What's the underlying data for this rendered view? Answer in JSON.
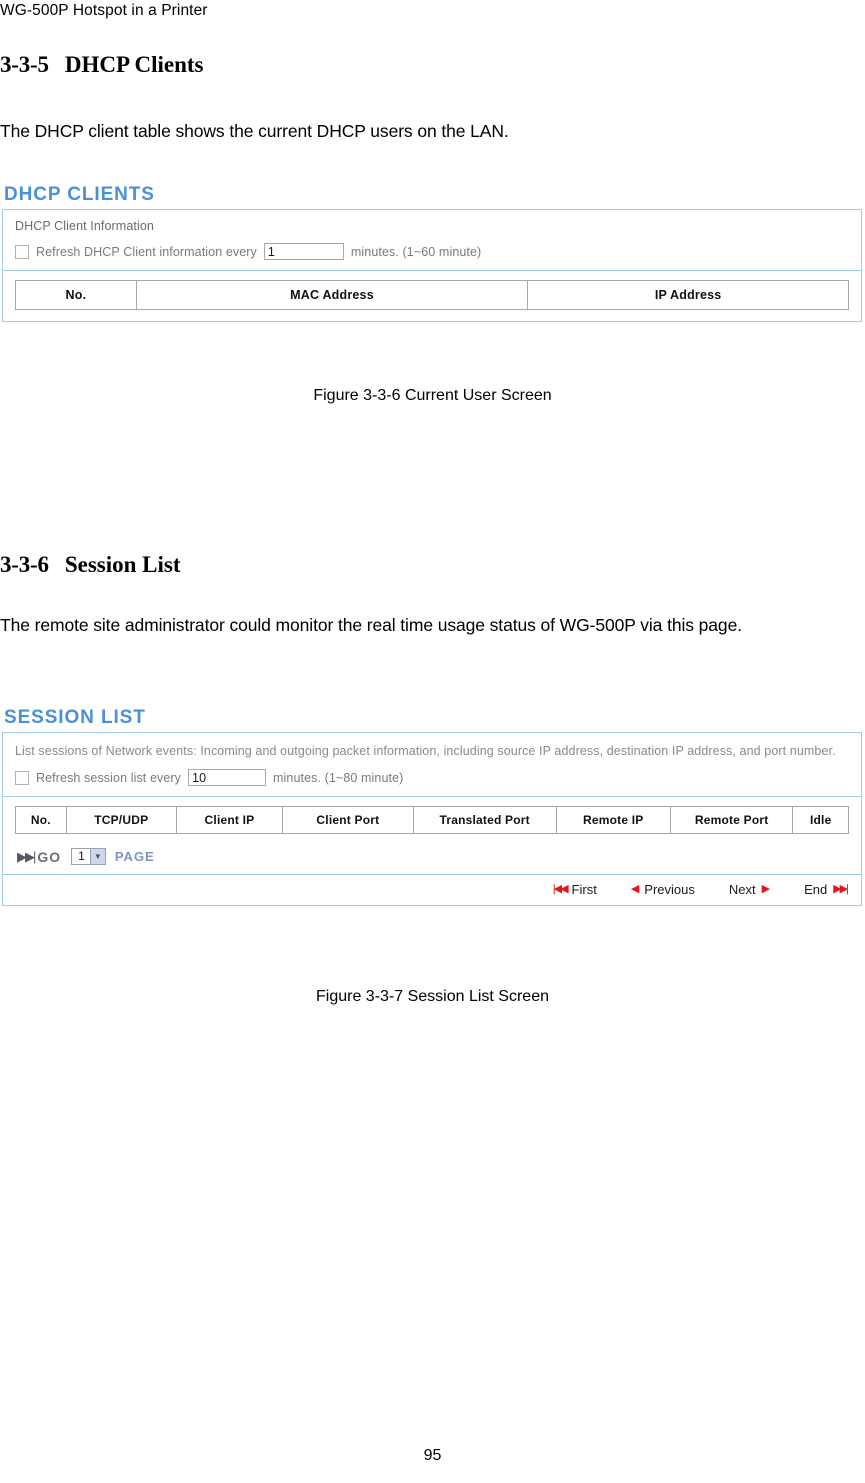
{
  "document": {
    "running_header": "WG-500P Hotspot in a Printer",
    "page_number": "95",
    "sections": [
      {
        "number": "3-3-5",
        "title": "DHCP Clients",
        "body": "The DHCP client table shows the current DHCP users on the LAN.",
        "caption": "Figure 3-3-6 Current User Screen"
      },
      {
        "number": "3-3-6",
        "title": "Session List",
        "body": "The remote site administrator could monitor the real time usage status of WG-500P via this page.",
        "caption": "Figure 3-3-7 Session List Screen"
      }
    ]
  },
  "theme": {
    "accent_blue": "#4a90d9",
    "panel_border": "#9fc9e8",
    "table_border": "#a6a6a6",
    "muted_text": "#8a8a8a",
    "pager_arrow_red": "#e8141c",
    "select_arrow_bg": "#cdd8ea",
    "page_word_blue": "#7f93c0"
  },
  "dhcp_clients_screen": {
    "title": "DHCP CLIENTS",
    "section_label": "DHCP Client Information",
    "refresh": {
      "checkbox_checked": false,
      "label_before": "Refresh DHCP Client information every",
      "value": "1",
      "label_after": "minutes. (1~60 minute)"
    },
    "table": {
      "columns": [
        "No.",
        "MAC Address",
        "IP Address"
      ],
      "rows": []
    }
  },
  "session_list_screen": {
    "title": "SESSION LIST",
    "description": "List sessions of Network events: Incoming and outgoing packet information, including source IP address, destination IP address, and port number.",
    "refresh": {
      "checkbox_checked": false,
      "label_before": "Refresh session list every",
      "value": "10",
      "label_after": "minutes. (1~80 minute)"
    },
    "table": {
      "columns": [
        "No.",
        "TCP/UDP",
        "Client IP",
        "Client Port",
        "Translated Port",
        "Remote IP",
        "Remote Port",
        "Idle"
      ],
      "rows": []
    },
    "go_bar": {
      "go_icon": "skip-forward-icon",
      "go_label": "GO",
      "page_select_value": "1",
      "page_select_options": [
        "1"
      ],
      "page_label": "PAGE"
    },
    "pagination": [
      {
        "icon": "double-arrow-left-icon",
        "label": "First",
        "icon_side": "left"
      },
      {
        "icon": "arrow-left-icon",
        "label": "Previous",
        "icon_side": "left"
      },
      {
        "icon": "arrow-right-icon",
        "label": "Next",
        "icon_side": "right"
      },
      {
        "icon": "double-arrow-right-icon",
        "label": "End",
        "icon_side": "right"
      }
    ]
  }
}
